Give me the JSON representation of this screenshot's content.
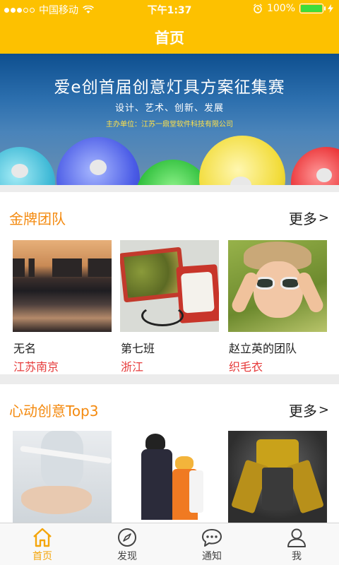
{
  "status_bar": {
    "carrier": "中国移动",
    "time": "下午1:37",
    "battery": "100%"
  },
  "header": {
    "title": "首页"
  },
  "banner": {
    "title": "爱e创首届创意灯具方案征集赛",
    "subtitle": "设计、艺术、创新、发展",
    "organizer": "主办单位：江苏一鼎堂软件科技有限公司"
  },
  "gold_team": {
    "title": "金牌团队",
    "more": "更多",
    "items": [
      {
        "name": "无名",
        "location": "江苏南京"
      },
      {
        "name": "第七班",
        "location": "浙江"
      },
      {
        "name": "赵立英的团队",
        "location": "织毛衣"
      }
    ]
  },
  "top3": {
    "title": "心动创意Top3",
    "more": "更多"
  },
  "tabbar": {
    "items": [
      {
        "label": "首页",
        "icon": "home-icon",
        "active": true
      },
      {
        "label": "发现",
        "icon": "compass-icon",
        "active": false
      },
      {
        "label": "通知",
        "icon": "chat-bubble-icon",
        "active": false
      },
      {
        "label": "我",
        "icon": "person-icon",
        "active": false
      }
    ]
  },
  "colors": {
    "accent": "#fdc100",
    "section_title": "#f48a0f",
    "location": "#e63b3b",
    "tab_active": "#f4a50a"
  }
}
